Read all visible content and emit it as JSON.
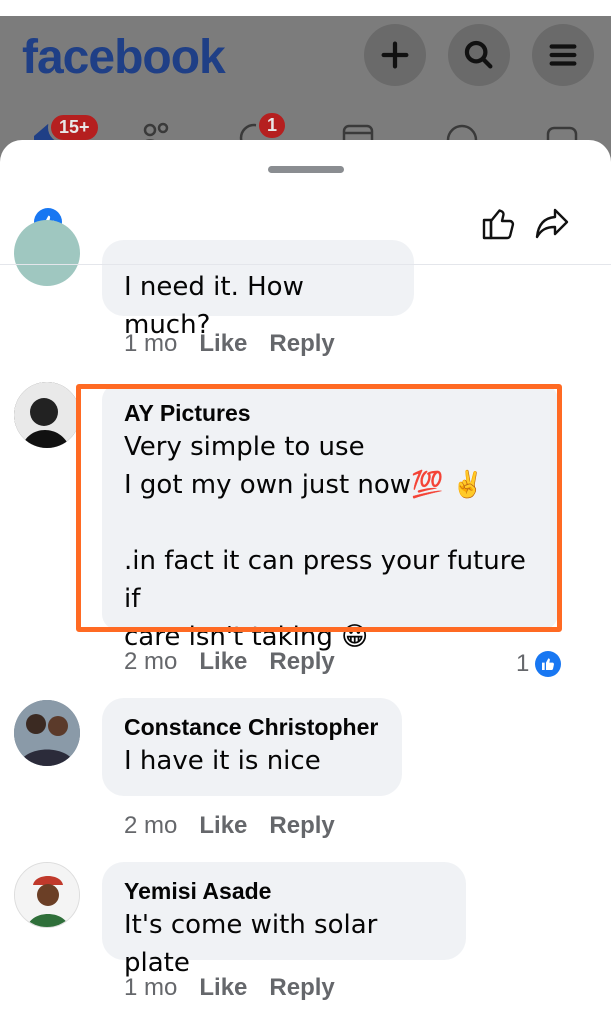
{
  "app": {
    "logo_text": "facebook",
    "notification_badge": "15+",
    "groups_badge": "1",
    "brand_color": "#1877f2",
    "highlight_color": "#ff6a23"
  },
  "header_icons": [
    "plus-icon",
    "search-icon",
    "menu-icon"
  ],
  "comments": [
    {
      "author": "",
      "text_lines": [
        "I need it. How much?"
      ],
      "time": "1 mo",
      "like_label": "Like",
      "reply_label": "Reply"
    },
    {
      "author": "AY Pictures",
      "text_lines": [
        "Very simple to use",
        "I got my own just now💯 ✌️",
        "",
        ".in fact it can press your future if",
        "care isn't taking 😀"
      ],
      "time": "2 mo",
      "like_label": "Like",
      "reply_label": "Reply",
      "reaction_count": "1"
    },
    {
      "author": "Constance Christopher",
      "text_lines": [
        "I have it is nice"
      ],
      "time": "2 mo",
      "like_label": "Like",
      "reply_label": "Reply"
    },
    {
      "author": "Yemisi Asade",
      "text_lines": [
        "It's come with solar plate"
      ],
      "time": "1 mo",
      "like_label": "Like",
      "reply_label": "Reply"
    }
  ]
}
